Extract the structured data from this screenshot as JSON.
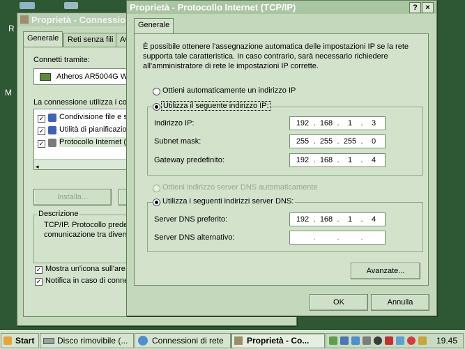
{
  "back_window": {
    "title": "Proprietà - Connessione",
    "tabs": [
      "Generale",
      "Reti senza fili",
      "Av"
    ],
    "connect_label": "Connetti tramite:",
    "adapter": "Atheros AR5004G W",
    "uses_label": "La connessione utilizza i co",
    "items": [
      "Condivisione file e s",
      "Utilità di pianificazio",
      "Protocollo Internet ("
    ],
    "install_button": "Installa...",
    "description_label": "Descrizione",
    "description_text_1": "TCP/IP. Protocollo prede",
    "description_text_2": "comunicazione tra divers",
    "show_icon": "Mostra un'icona sull'are",
    "notify": "Notifica in caso di conne"
  },
  "desktop_letters": [
    "R",
    "M"
  ],
  "dialog": {
    "title": "Proprietà - Protocollo Internet (TCP/IP)",
    "help_button": "?",
    "close_button": "×",
    "tab": "Generale",
    "intro_1": "È possibile ottenere l'assegnazione automatica delle impostazioni IP se la rete",
    "intro_2": "supporta tale caratteristica. In caso contrario, sarà necessario richiedere",
    "intro_3": "all'amministratore di rete le impostazioni IP corrette.",
    "auto_ip": "Ottieni automaticamente un indirizzo IP",
    "manual_ip": "Utilizza il seguente indirizzo IP:",
    "ip_label": "Indirizzo IP:",
    "ip": [
      "192",
      "168",
      "1",
      "3"
    ],
    "subnet_label": "Subnet mask:",
    "subnet": [
      "255",
      "255",
      "255",
      "0"
    ],
    "gateway_label": "Gateway predefinito:",
    "gateway": [
      "192",
      "168",
      "1",
      "4"
    ],
    "auto_dns": "Ottieni indirizzo server DNS automaticamente",
    "manual_dns": "Utilizza i seguenti indirizzi server DNS:",
    "dns1_label": "Server DNS preferito:",
    "dns1": [
      "192",
      "168",
      "1",
      "4"
    ],
    "dns2_label": "Server DNS alternativo:",
    "dns2": [
      "",
      "",
      "",
      ""
    ],
    "advanced_button": "Avanzate...",
    "ok_button": "OK",
    "cancel_button": "Annulla"
  },
  "taskbar": {
    "start": "Start",
    "tasks": [
      "Disco rimovibile (...",
      "Connessioni di rete",
      "Proprietà - Co..."
    ],
    "clock": "19.45"
  }
}
